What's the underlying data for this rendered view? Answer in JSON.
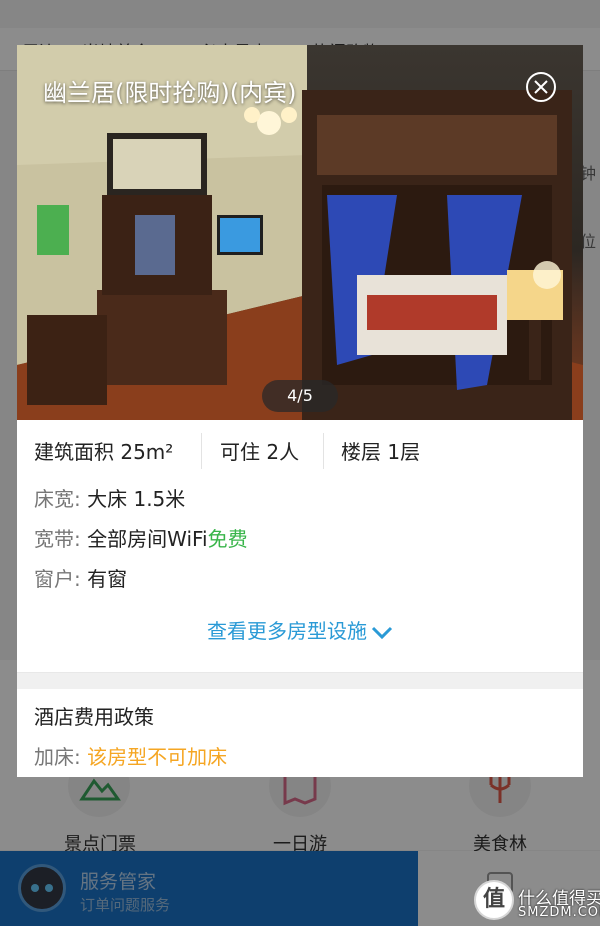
{
  "background": {
    "tabs": [
      "周边",
      "当地美食",
      "必去景点",
      "热门购物"
    ],
    "side_texts": [
      "钟",
      "位"
    ],
    "categories": [
      {
        "label": "景点门票",
        "icon": "mountain-icon"
      },
      {
        "label": "一日游",
        "icon": "map-icon"
      },
      {
        "label": "美食林",
        "icon": "fork-icon"
      }
    ],
    "service": {
      "title": "服务管家",
      "subtitle": "订单问题服务"
    }
  },
  "modal": {
    "title": "幽兰居(限时抢购)(内宾)",
    "photo_counter": "4/5",
    "stats": [
      {
        "label": "建筑面积",
        "value": "25m²"
      },
      {
        "label": "可住",
        "value": "2人"
      },
      {
        "label": "楼层",
        "value": "1层"
      }
    ],
    "details": [
      {
        "key": "床宽:",
        "value": "大床 1.5米"
      },
      {
        "key": "宽带:",
        "value": "全部房间WiFi",
        "highlight": "免费"
      },
      {
        "key": "窗户:",
        "value": "有窗"
      }
    ],
    "more_link": "查看更多房型设施",
    "policy": {
      "title": "酒店费用政策",
      "key": "加床:",
      "value": "该房型不可加床"
    }
  },
  "watermark": {
    "glyph": "值",
    "text": "什么值得买",
    "sub": "SMZDM.COM"
  },
  "colors": {
    "link": "#2a9ad6",
    "free": "#39b54a",
    "warn": "#f5a623",
    "service": "#1a73c8"
  }
}
